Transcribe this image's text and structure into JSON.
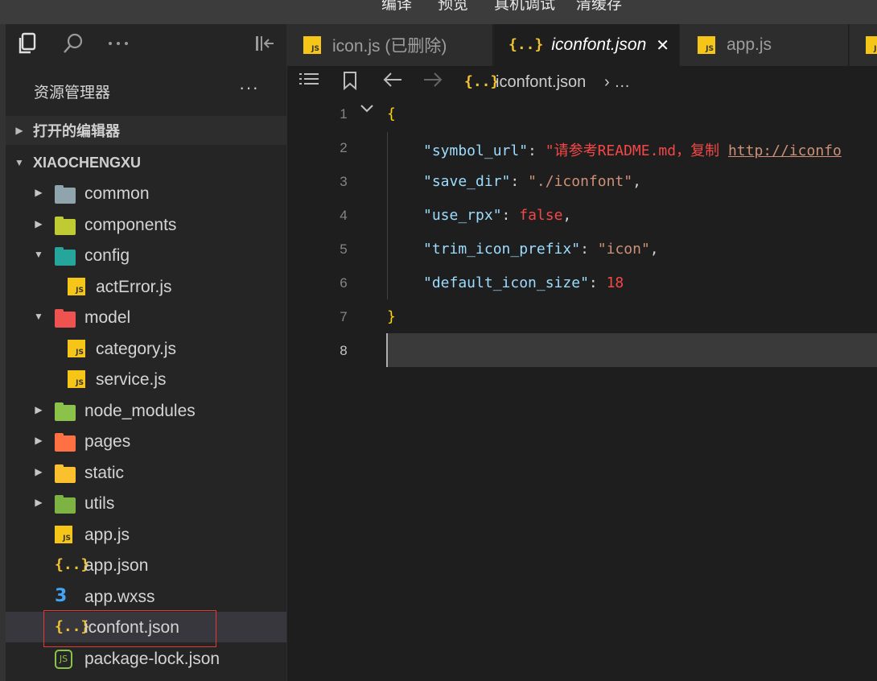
{
  "menu": [
    "编译",
    "预览",
    "真机调试",
    "清缓存"
  ],
  "sidebar": {
    "title": "资源管理器",
    "more": "···",
    "sections": {
      "open_editors": "打开的编辑器",
      "project": "XIAOCHENGXU"
    },
    "tree": [
      {
        "name": "common",
        "type": "folder",
        "expanded": false,
        "color": "#90a4ae"
      },
      {
        "name": "components",
        "type": "folder",
        "expanded": false,
        "color": "#c0ca33"
      },
      {
        "name": "config",
        "type": "folder",
        "expanded": true,
        "color": "#26a69a"
      },
      {
        "name": "actError.js",
        "type": "js"
      },
      {
        "name": "model",
        "type": "folder",
        "expanded": true,
        "color": "#ef5350"
      },
      {
        "name": "category.js",
        "type": "js"
      },
      {
        "name": "service.js",
        "type": "js"
      },
      {
        "name": "node_modules",
        "type": "folder",
        "expanded": false,
        "color": "#8bc34a"
      },
      {
        "name": "pages",
        "type": "folder",
        "expanded": false,
        "color": "#ff7043"
      },
      {
        "name": "static",
        "type": "folder",
        "expanded": false,
        "color": "#fbc02d"
      },
      {
        "name": "utils",
        "type": "folder",
        "expanded": false,
        "color": "#7cb342"
      },
      {
        "name": "app.js",
        "type": "js"
      },
      {
        "name": "app.json",
        "type": "json"
      },
      {
        "name": "app.wxss",
        "type": "css"
      },
      {
        "name": "iconfont.json",
        "type": "json",
        "selected": true
      },
      {
        "name": "package-lock.json",
        "type": "node"
      }
    ]
  },
  "tabs": [
    {
      "label": "icon.js (已删除)",
      "icon": "js"
    },
    {
      "label": "iconfont.json",
      "icon": "json",
      "active": true,
      "close": "✕"
    },
    {
      "label": "app.js",
      "icon": "js"
    }
  ],
  "breadcrumb": {
    "file": "iconfont.json",
    "more": "› …"
  },
  "editor": {
    "line_numbers": [
      "1",
      "2",
      "3",
      "4",
      "5",
      "6",
      "7",
      "8"
    ],
    "open_brace": "{",
    "close_brace": "}",
    "lines": [
      {
        "key": "\"symbol_url\"",
        "value": "\"请参考README.md，复制 ",
        "link": "http://iconfo"
      },
      {
        "key": "\"save_dir\"",
        "value": "\"./iconfont\"",
        "trail": ","
      },
      {
        "key": "\"use_rpx\"",
        "value": "false",
        "trail": ","
      },
      {
        "key": "\"trim_icon_prefix\"",
        "value": "\"icon\"",
        "trail": ","
      },
      {
        "key": "\"default_icon_size\"",
        "value": "18",
        "trail": ""
      }
    ]
  },
  "icons": {
    "files": "files-icon",
    "search": "search-icon",
    "more": "more-icon",
    "collapse": "collapse-panel-icon",
    "list": "list-icon",
    "bookmark": "bookmark-icon",
    "back": "arrow-left-icon",
    "forward": "arrow-right-icon"
  }
}
